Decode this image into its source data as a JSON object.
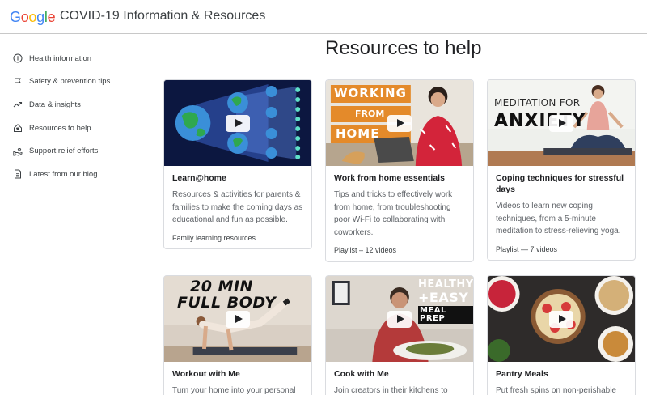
{
  "header": {
    "logo_text": "Google",
    "logo_colors": [
      "#4285f4",
      "#ea4335",
      "#fbbc05",
      "#4285f4",
      "#34a853",
      "#ea4335"
    ],
    "site_title": "COVID-19 Information & Resources"
  },
  "sidebar": {
    "items": [
      {
        "label": "Health information",
        "icon": "info-icon"
      },
      {
        "label": "Safety & prevention tips",
        "icon": "flag-icon"
      },
      {
        "label": "Data & insights",
        "icon": "trending-icon"
      },
      {
        "label": "Resources to help",
        "icon": "home-heart-icon"
      },
      {
        "label": "Support relief efforts",
        "icon": "hand-heart-icon"
      },
      {
        "label": "Latest from our blog",
        "icon": "document-icon"
      }
    ]
  },
  "main": {
    "section_title": "Resources to help",
    "cards": [
      {
        "title": "Learn@home",
        "description": "Resources & activities for parents & families to make the coming days as educational and fun as possible.",
        "meta": "Family learning resources"
      },
      {
        "title": "Work from home essentials",
        "description": "Tips and tricks to effectively work from home, from troubleshooting poor Wi-Fi to collaborating with coworkers.",
        "meta": "Playlist – 12 videos",
        "thumb_text": [
          "WORKING",
          "FROM",
          "HOME"
        ]
      },
      {
        "title": "Coping techniques for stressful days",
        "description": "Videos to learn new coping techniques, from a 5-minute meditation to stress-relieving yoga.",
        "meta": "Playlist — 7 videos",
        "thumb_text": [
          "MEDITATION FOR",
          "ANXIETY"
        ]
      },
      {
        "title": "Workout with Me",
        "description": "Turn your home into your personal",
        "thumb_text": [
          "20 MIN",
          "FULL BODY"
        ]
      },
      {
        "title": "Cook with Me",
        "description": "Join creators in their kitchens to",
        "thumb_text": [
          "HEALTHY",
          "+EASY",
          "MEAL PREP"
        ]
      },
      {
        "title": "Pantry Meals",
        "description": "Put fresh spins on non-perishable"
      }
    ]
  }
}
